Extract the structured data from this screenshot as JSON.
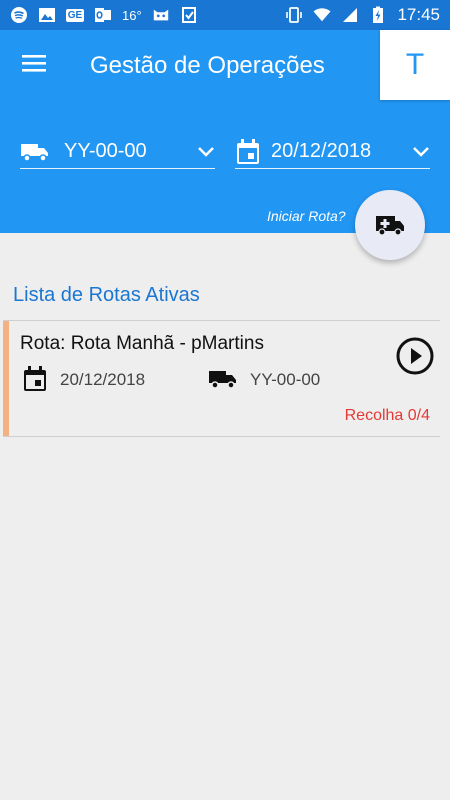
{
  "status_bar": {
    "time": "17:45",
    "left_icons": [
      "spotify-icon",
      "image-icon",
      "ge-icon",
      "outlook-icon",
      "temperature-icon",
      "cat-icon",
      "check-icon"
    ],
    "temperature": "16°",
    "ge_label": "GE",
    "right_icons": [
      "vibrate-icon",
      "wifi-icon",
      "signal-icon",
      "battery-charging-icon"
    ]
  },
  "header": {
    "title": "Gestão de Operações",
    "avatar_letter": "T",
    "vehicle_value": "YY-00-00",
    "date_value": "20/12/2018",
    "start_route_label": "Iniciar Rota?"
  },
  "main": {
    "section_title": "Lista de Rotas Ativas",
    "routes": [
      {
        "title": "Rota: Rota Manhã - pMartins",
        "date": "20/12/2018",
        "plate": "YY-00-00",
        "status": "Recolha 0/4",
        "accent_color": "#f4b183"
      }
    ]
  },
  "colors": {
    "primary": "#2196f3",
    "primary_dark": "#1976d2",
    "background": "#eeeeee",
    "status_red": "#e53935"
  }
}
